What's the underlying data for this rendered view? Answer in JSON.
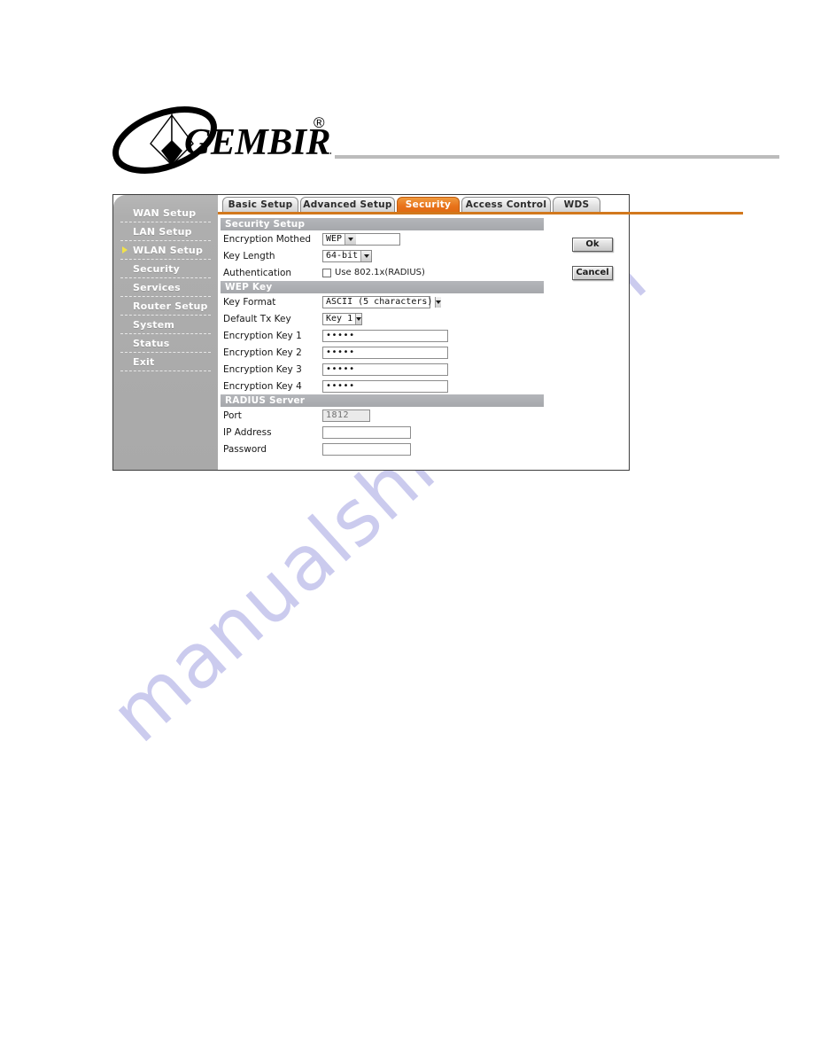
{
  "watermark": {
    "text": "manualshive.com"
  },
  "brand": {
    "name": "GEMBIRD",
    "registered": "®"
  },
  "sidebar": {
    "items": [
      {
        "label": "WAN Setup",
        "active": false
      },
      {
        "label": "LAN Setup",
        "active": false
      },
      {
        "label": "WLAN Setup",
        "active": true
      },
      {
        "label": "Security",
        "active": false
      },
      {
        "label": "Services",
        "active": false
      },
      {
        "label": "Router Setup",
        "active": false
      },
      {
        "label": "System",
        "active": false
      },
      {
        "label": "Status",
        "active": false
      },
      {
        "label": "Exit",
        "active": false
      }
    ]
  },
  "tabs": [
    {
      "label": "Basic Setup",
      "active": false
    },
    {
      "label": "Advanced Setup",
      "active": false
    },
    {
      "label": "Security",
      "active": true
    },
    {
      "label": "Access Control",
      "active": false
    },
    {
      "label": "WDS",
      "active": false
    }
  ],
  "sections": {
    "security_setup": {
      "title": "Security Setup",
      "encryption_method": {
        "label": "Encryption Mothed",
        "value": "WEP"
      },
      "key_length": {
        "label": "Key Length",
        "value": "64-bit"
      },
      "authentication": {
        "label": "Authentication",
        "checkbox_label": "Use 802.1x(RADIUS)",
        "checked": false
      }
    },
    "wep_key": {
      "title": "WEP Key",
      "key_format": {
        "label": "Key Format",
        "value": "ASCII (5 characters)"
      },
      "default_tx_key": {
        "label": "Default Tx Key",
        "value": "Key 1"
      },
      "keys": [
        {
          "label": "Encryption Key 1",
          "value": "•••••"
        },
        {
          "label": "Encryption Key 2",
          "value": "•••••"
        },
        {
          "label": "Encryption Key 3",
          "value": "•••••"
        },
        {
          "label": "Encryption Key 4",
          "value": "•••••"
        }
      ]
    },
    "radius_server": {
      "title": "RADIUS Server",
      "port": {
        "label": "Port",
        "value": "1812"
      },
      "ip_address": {
        "label": "IP Address",
        "value": ""
      },
      "password": {
        "label": "Password",
        "value": ""
      }
    }
  },
  "buttons": {
    "ok": "Ok",
    "cancel": "Cancel"
  },
  "colors": {
    "accent_orange": "#e8721a",
    "tab_underline": "#d2781d",
    "section_bar": "#a8aaae",
    "sidebar": "#aeaeae",
    "arrow_yellow": "#f2e24a",
    "watermark": "#c9c9ee"
  }
}
